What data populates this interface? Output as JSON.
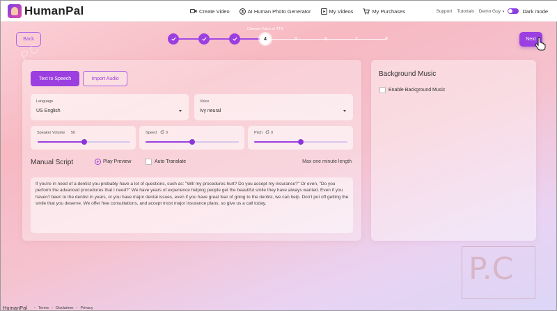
{
  "app": {
    "logo_text": "HumanPal"
  },
  "nav": {
    "create_video": "Create Video",
    "photo_generator": "AI Human Photo Generator",
    "my_videos": "My Videos",
    "my_purchases": "My Purchases"
  },
  "user_nav": {
    "support": "Support",
    "tutorials": "Tutorials",
    "user_name": "Demo Guy",
    "dark_mode": "Dark mode"
  },
  "wizard": {
    "back_label": "Back",
    "next_label": "Next",
    "current_step_title": "Choose Voice or TTS",
    "steps": [
      "1",
      "2",
      "3",
      "4",
      "5",
      "6",
      "7",
      "8"
    ],
    "current_step": 4
  },
  "tabs": {
    "tts": "Text to Speech",
    "import": "Import Audio"
  },
  "language": {
    "label": "Language",
    "value": "US English"
  },
  "voice": {
    "label": "Voice",
    "value": "Ivy neural"
  },
  "sliders": {
    "speaker_volume": {
      "label": "Speaker Volume",
      "value": "50",
      "level": 0.5
    },
    "speed": {
      "label": "Speed",
      "value": "0",
      "level": 0.5
    },
    "pitch": {
      "label": "Pitch",
      "value": "0",
      "level": 0.5
    }
  },
  "script": {
    "title": "Manual Script",
    "play_preview": "Play Preview",
    "auto_translate": "Auto Translate",
    "max_length": "Max one minute length",
    "text": "If you're in need of a dentist you probably have a lot of questions, such as: \"Will my procedures hurt? Do you accept my insurance?\" Or even, \"Do you perform the advanced procedures that I need?\" We have years of experience helping people get the beautiful smile they have always wanted. Even if you haven't been to the dentist in years, or you have major dental issues, even if you have great fear of going to the dentist, we can help. Don't put off getting the smile that you deserve. We offer free consultations, and accept most major insurance plans, so give us a call today."
  },
  "music": {
    "title": "Background Music",
    "enable_label": "Enable Background Music"
  },
  "footer": {
    "brand": "HumanPal",
    "terms": "Terms",
    "disclaimer": "Disclaimer",
    "privacy": "Privacy"
  },
  "watermark": {
    "text": "P.C"
  },
  "colors": {
    "accent": "#9b3fe1",
    "accent_border": "#b063e8"
  }
}
